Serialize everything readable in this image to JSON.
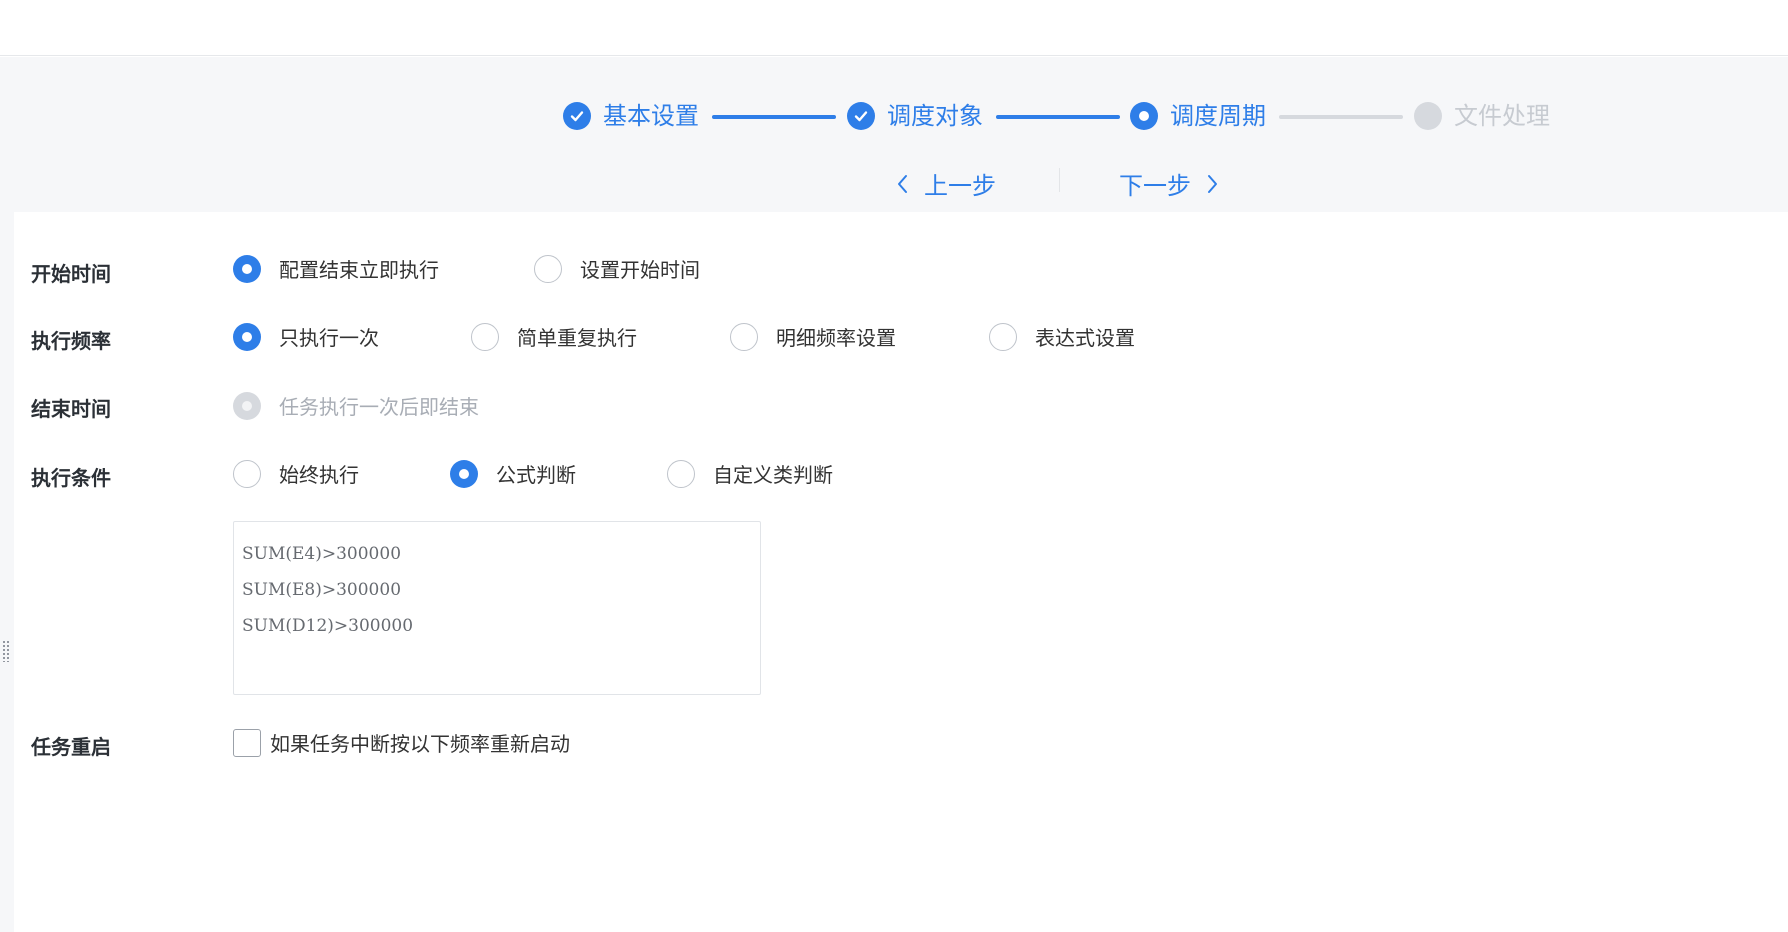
{
  "steps": [
    {
      "label": "基本设置",
      "state": "done"
    },
    {
      "label": "调度对象",
      "state": "done"
    },
    {
      "label": "调度周期",
      "state": "current"
    },
    {
      "label": "文件处理",
      "state": "todo"
    }
  ],
  "nav": {
    "prev_label": "上一步",
    "next_label": "下一步"
  },
  "form": {
    "start_time": {
      "label": "开始时间",
      "options": [
        "配置结束立即执行",
        "设置开始时间"
      ],
      "selected": "配置结束立即执行"
    },
    "frequency": {
      "label": "执行频率",
      "options": [
        "只执行一次",
        "简单重复执行",
        "明细频率设置",
        "表达式设置"
      ],
      "selected": "只执行一次"
    },
    "end_time": {
      "label": "结束时间",
      "options": [
        "任务执行一次后即结束"
      ],
      "selected": "任务执行一次后即结束",
      "disabled": true
    },
    "condition": {
      "label": "执行条件",
      "options": [
        "始终执行",
        "公式判断",
        "自定义类判断"
      ],
      "selected": "公式判断",
      "formulas": [
        "SUM(E4)>300000",
        "SUM(E8)>300000",
        "SUM(D12)>300000"
      ]
    },
    "restart": {
      "label": "任务重启",
      "checkbox_label": "如果任务中断按以下频率重新启动",
      "checked": false
    }
  },
  "colors": {
    "accent": "#2e7ee8",
    "inactive": "#d6d9de",
    "header_bg": "#f6f7f9"
  },
  "icons": {
    "done": "check-circle-icon",
    "current": "dot-circle-icon",
    "todo": "gray-dot-icon",
    "prev": "chevron-left-icon",
    "next": "chevron-right-icon"
  }
}
